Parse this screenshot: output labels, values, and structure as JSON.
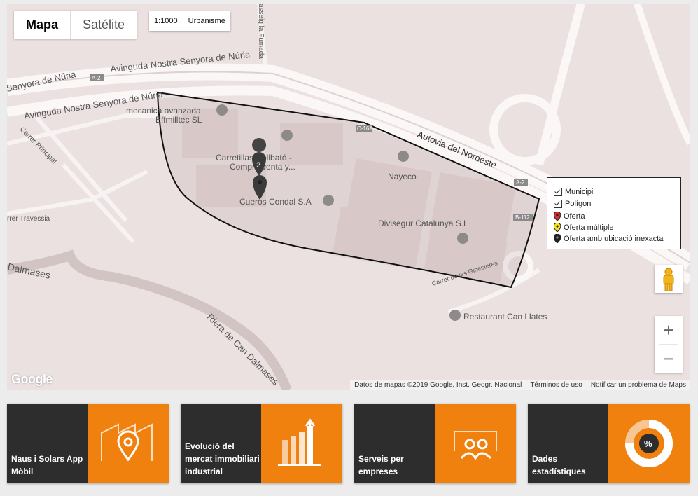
{
  "map": {
    "type_buttons": [
      "Mapa",
      "Satélite"
    ],
    "selected_type": "Mapa",
    "scale_button": "1:1000",
    "layer_button": "Urbanisme",
    "road_labels": {
      "avinguda_top": "Avinguda Nostra Senyora de Núria",
      "avinguda_left": "Senyora de Núria",
      "avinguda_lower": "Avinguda Nostra Senyora de Núria",
      "autovia": "Autovia del Nordeste",
      "passeig": "asseig la Fumada",
      "carrer_principal": "Carrer Principal",
      "carrer_travessia": "rrer Travessia",
      "dalmases": "Dalmases",
      "riera": "Riera de Can Dalmases",
      "ginesteres": "Carrer de les Ginesteres"
    },
    "road_shields": [
      "A-2",
      "A-2",
      "A-2",
      "B-112",
      "C-16A"
    ],
    "places": {
      "mecanica": [
        "mecanica avanzada",
        "Effmilltec SL"
      ],
      "carretillas": [
        "Carretillas Collbató -",
        "Compra venta y..."
      ],
      "cueros": "Cueros Condal S.A",
      "nayeco": "Nayeco",
      "divisegur": "Divisegur Catalunya S.L",
      "restaurant": "Restaurant Can Llates"
    },
    "marker_count": "2",
    "legend": {
      "municipi": "Municipi",
      "poligon": "Polígon",
      "oferta": "Oferta",
      "oferta_multiple": "Oferta múltiple",
      "oferta_inexacta": "Oferta amb ubicació inexacta"
    },
    "legend_colors": {
      "oferta": "#d32f2f",
      "oferta_multiple": "#f5e31b",
      "oferta_inexacta": "#222222"
    },
    "zoom_in": "+",
    "zoom_out": "−",
    "google_logo": "Google",
    "attribution": [
      "Datos de mapas ©2019 Google, Inst. Geogr. Nacional",
      "Términos de uso",
      "Notificar un problema de Maps"
    ]
  },
  "tiles": [
    {
      "label": "Naus i Solars App Mòbil",
      "icon": "factory-location-icon"
    },
    {
      "label": "Evolució del mercat immobiliari industrial",
      "icon": "bar-chart-icon"
    },
    {
      "label": "Serveis per empreses",
      "icon": "users-icon"
    },
    {
      "label": "Dades estadístiques",
      "icon": "percent-donut-icon"
    }
  ],
  "colors": {
    "accent": "#f0810f",
    "tile_dark": "#2d2d2d",
    "map_bg": "#ece1e1"
  }
}
